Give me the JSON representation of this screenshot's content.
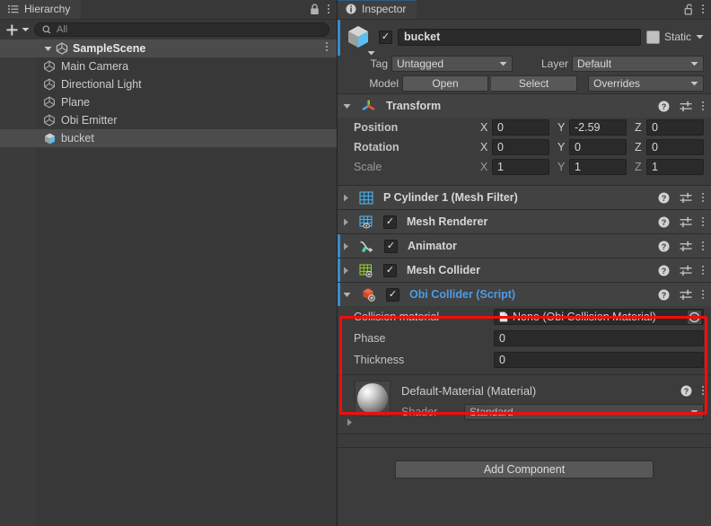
{
  "hierarchy": {
    "tab_label": "Hierarchy",
    "tab_icon": "hierarchy-list-icon",
    "lock_icon": "lock-closed-icon",
    "menu_icon": "kebab-menu-icon",
    "create_label": "+",
    "search": {
      "placeholder": "All",
      "value": "",
      "icon": "search-icon"
    },
    "items": [
      {
        "label": "SampleScene",
        "icon": "unity-scene-icon",
        "depth": 0,
        "expanded": true,
        "selected": false,
        "kebab": true
      },
      {
        "label": "Main Camera",
        "icon": "gameobject-cube-icon",
        "depth": 1,
        "selected": false
      },
      {
        "label": "Directional Light",
        "icon": "gameobject-cube-icon",
        "depth": 1,
        "selected": false
      },
      {
        "label": "Plane",
        "icon": "gameobject-cube-icon",
        "depth": 1,
        "selected": false
      },
      {
        "label": "Obi Emitter",
        "icon": "gameobject-cube-icon",
        "depth": 1,
        "selected": false
      },
      {
        "label": "bucket",
        "icon": "prefab-cube-icon",
        "depth": 1,
        "selected": true
      }
    ]
  },
  "inspector": {
    "tab_label": "Inspector",
    "tab_icon": "info-circle-icon",
    "lock_icon": "lock-open-icon",
    "menu_icon": "kebab-menu-icon",
    "object": {
      "enabled_checkbox": true,
      "name": "bucket",
      "icon": "prefab-cube-icon",
      "static_label": "Static",
      "static_checked": false,
      "tag_label": "Tag",
      "tag_value": "Untagged",
      "layer_label": "Layer",
      "layer_value": "Default",
      "model_label": "Model",
      "open_button": "Open",
      "select_button": "Select",
      "overrides_button": "Overrides"
    },
    "transform": {
      "title": "Transform",
      "icon": "transform-axes-icon",
      "expanded": true,
      "rows": [
        {
          "label": "Position",
          "dim": false,
          "x": "0",
          "y": "-2.59",
          "z": "0"
        },
        {
          "label": "Rotation",
          "dim": false,
          "x": "0",
          "y": "0",
          "z": "0"
        },
        {
          "label": "Scale",
          "dim": true,
          "x": "1",
          "y": "1",
          "z": "1"
        }
      ],
      "axis_labels": [
        "X",
        "Y",
        "Z"
      ]
    },
    "components": [
      {
        "title": "P Cylinder 1 (Mesh Filter)",
        "icon": "mesh-filter-icon",
        "has_checkbox": false,
        "checked": false,
        "blue_rail": false,
        "expanded": false
      },
      {
        "title": "Mesh Renderer",
        "icon": "mesh-renderer-icon",
        "has_checkbox": true,
        "checked": true,
        "blue_rail": false,
        "expanded": false
      },
      {
        "title": "Animator",
        "icon": "animator-icon",
        "has_checkbox": true,
        "checked": true,
        "blue_rail": true,
        "expanded": false
      },
      {
        "title": "Mesh Collider",
        "icon": "mesh-collider-icon",
        "has_checkbox": true,
        "checked": true,
        "blue_rail": true,
        "expanded": false
      }
    ],
    "obi_collider": {
      "title": "Obi Collider (Script)",
      "title_color": "#4b9ce8",
      "icon": "obi-collider-script-icon",
      "has_checkbox": true,
      "checked": true,
      "expanded": true,
      "highlight_color": "#f60b0b",
      "properties": [
        {
          "label": "Collision material",
          "type": "object",
          "value": "None (Obi Collision Material)",
          "picker_icon": "object-picker-icon",
          "value_icon": "script-asset-icon"
        },
        {
          "label": "Phase",
          "type": "text",
          "value": "0"
        },
        {
          "label": "Thickness",
          "type": "text",
          "value": "0"
        }
      ]
    },
    "material": {
      "title": "Default-Material (Material)",
      "preview_icon": "material-sphere-preview",
      "shader_label": "Shader",
      "shader_value": "Standard",
      "help_icon": "help-circle-icon",
      "menu_icon": "kebab-menu-icon"
    },
    "add_component_label": "Add Component",
    "header_icons": {
      "help": "help-circle-icon",
      "preset": "preset-sliders-icon",
      "menu": "kebab-menu-icon"
    }
  },
  "colors": {
    "panel_bg": "#383838",
    "inspector_bg": "#3c3c3c",
    "component_header": "#424242",
    "accent_blue": "#4b9ce8",
    "rail_blue": "#2e8fd4",
    "highlight_red": "#f60b0b",
    "field_bg": "#2a2a2a"
  }
}
